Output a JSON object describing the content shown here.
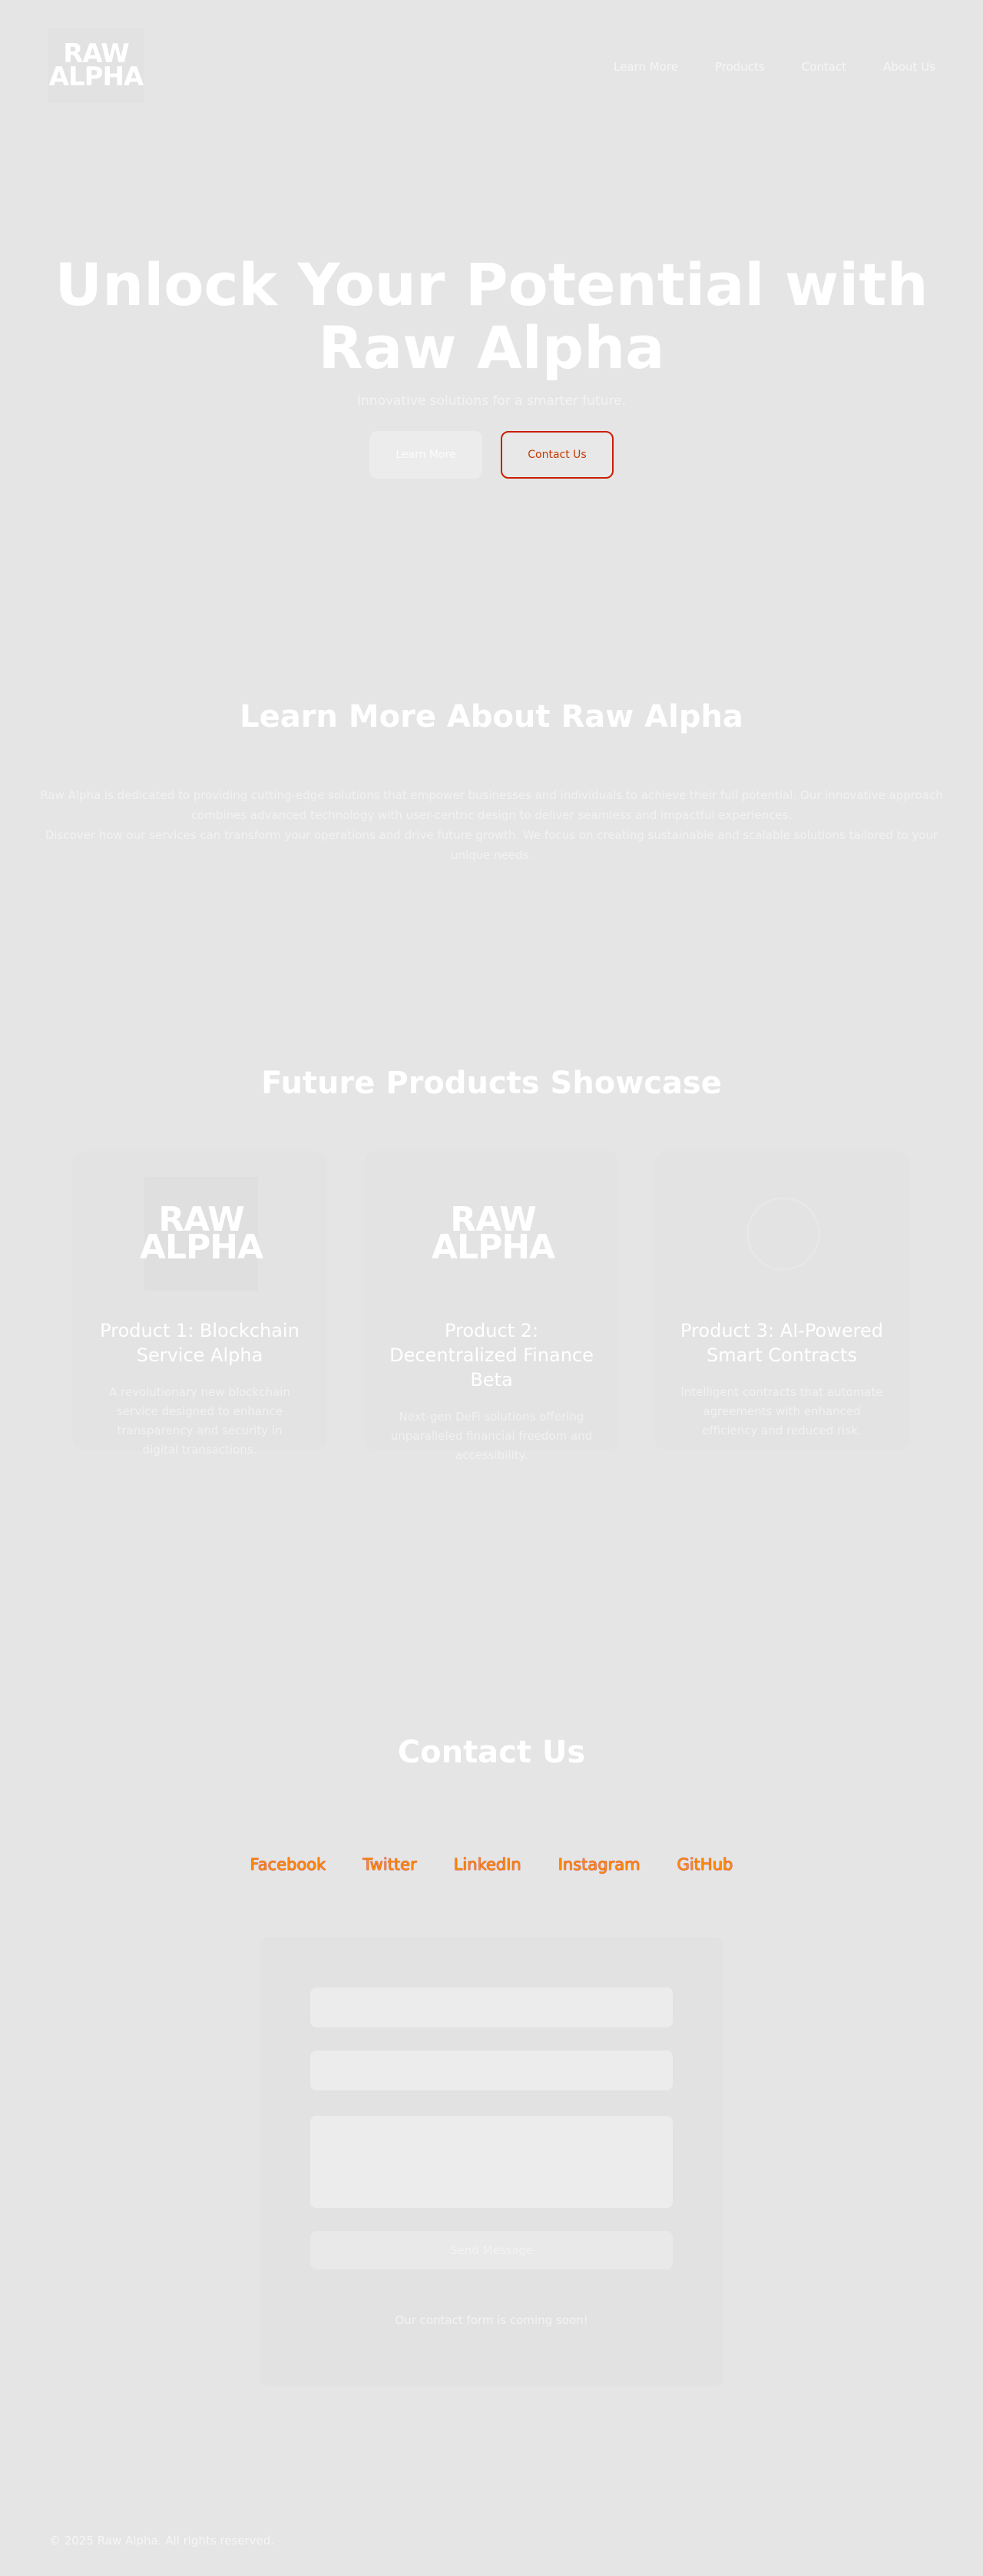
{
  "header": {
    "logo": {
      "line1": "RAW",
      "line2": "ALPHA"
    },
    "nav": [
      "Learn More",
      "Products",
      "Contact",
      "About Us"
    ]
  },
  "hero": {
    "title": "Unlock Your Potential with Raw Alpha",
    "subtitle": "Innovative solutions for a smarter future.",
    "learn_btn": "Learn More",
    "contact_btn": "Contact Us"
  },
  "about": {
    "title": "Learn More About Raw Alpha",
    "paragraph1": "Raw Alpha is dedicated to providing cutting-edge solutions that empower businesses and individuals to achieve their full potential. Our innovative approach combines advanced technology with user-centric design to deliver seamless and impactful experiences.",
    "paragraph2": "Discover how our services can transform your operations and drive future growth. We focus on creating sustainable and scalable solutions tailored to your unique needs."
  },
  "products": {
    "title": "Future Products Showcase",
    "items": [
      {
        "title": "Product 1: Blockchain Service Alpha",
        "description": "A revolutionary new blockchain service designed to enhance transparency and security in digital transactions.",
        "image": "raw-alpha-logo"
      },
      {
        "title": "Product 2: Decentralized Finance Beta",
        "description": "Next-gen DeFi solutions offering unparalleled financial freedom and accessibility.",
        "image": "raw-alpha-logo"
      },
      {
        "title": "Product 3: AI-Powered Smart Contracts",
        "description": "Intelligent contracts that automate agreements with enhanced efficiency and reduced risk.",
        "image": "broken-image-icon"
      }
    ]
  },
  "contact": {
    "title": "Contact Us",
    "social": [
      "Facebook",
      "Twitter",
      "LinkedIn",
      "Instagram",
      "GitHub"
    ],
    "form": {
      "name_placeholder": "",
      "email_placeholder": "",
      "message_placeholder": "",
      "send_label": "Send Message",
      "note": "Our contact form is coming soon!"
    }
  },
  "footer": {
    "text": "© 2025 Raw Alpha. All rights reserved."
  },
  "colors": {
    "background": "#e5e5e5",
    "link_accent": "#ff8c00",
    "link_outline": "#c00000",
    "contact_btn_border": "#cc1e00"
  }
}
